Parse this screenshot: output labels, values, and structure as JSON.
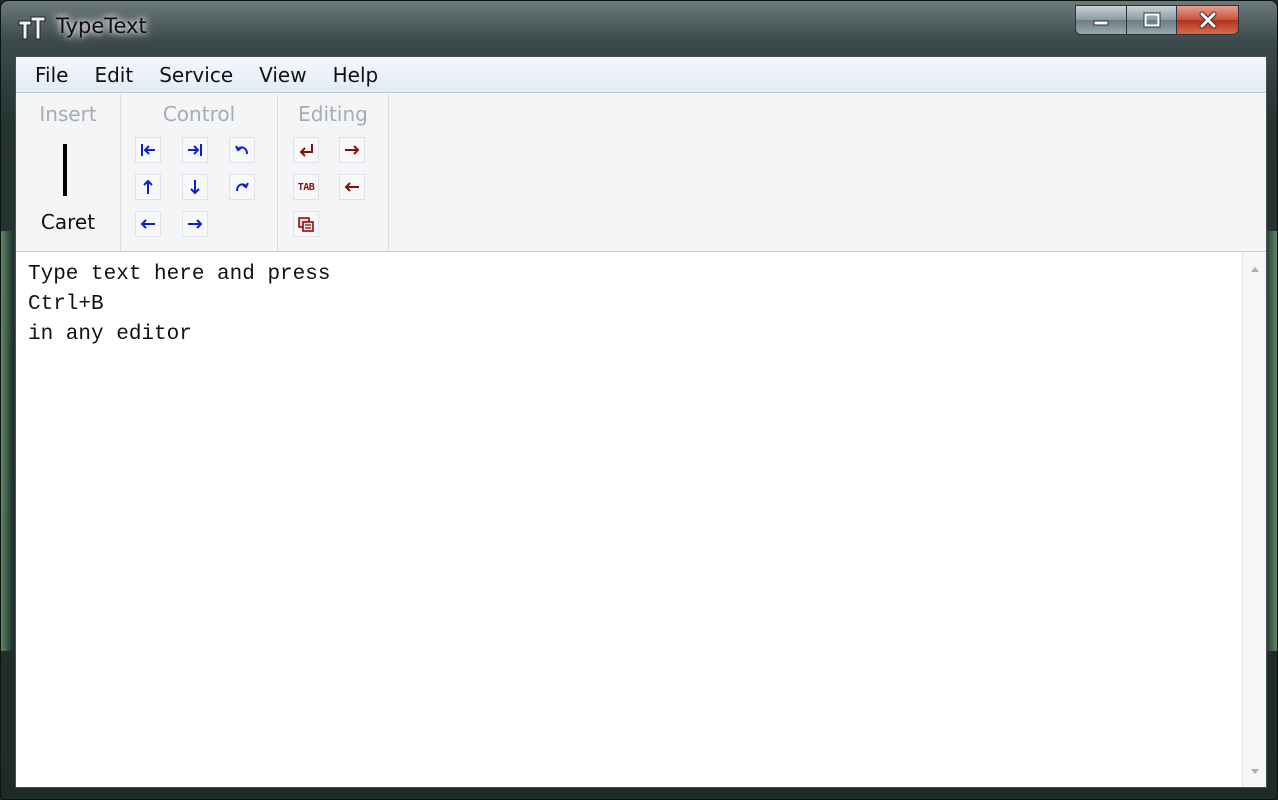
{
  "window": {
    "title": "TypeText",
    "buttons": {
      "minimize_icon": "minimize-icon",
      "maximize_icon": "maximize-icon",
      "close_icon": "close-icon"
    }
  },
  "menu": [
    "File",
    "Edit",
    "Service",
    "View",
    "Help"
  ],
  "toolbar": {
    "groups": {
      "insert": {
        "label": "Insert",
        "caret_label": "Caret"
      },
      "control": {
        "label": "Control"
      },
      "editing": {
        "label": "Editing"
      }
    },
    "control_icons": [
      "home-icon",
      "end-icon",
      "undo-icon",
      "up-arrow-icon",
      "down-arrow-icon",
      "redo-icon",
      "left-arrow-icon",
      "right-arrow-icon"
    ],
    "editing_icons": [
      "enter-icon",
      "delete-forward-icon",
      "tab-icon",
      "backspace-icon",
      "clipboard-icon"
    ],
    "tab_glyph": "TAB"
  },
  "editor": {
    "lines": [
      "Type text here and press",
      "Ctrl+B",
      "in any editor"
    ]
  },
  "colors": {
    "control_icon": "#0b1fcf",
    "editing_icon": "#8b0e0e",
    "close_button": "#c9503a"
  }
}
